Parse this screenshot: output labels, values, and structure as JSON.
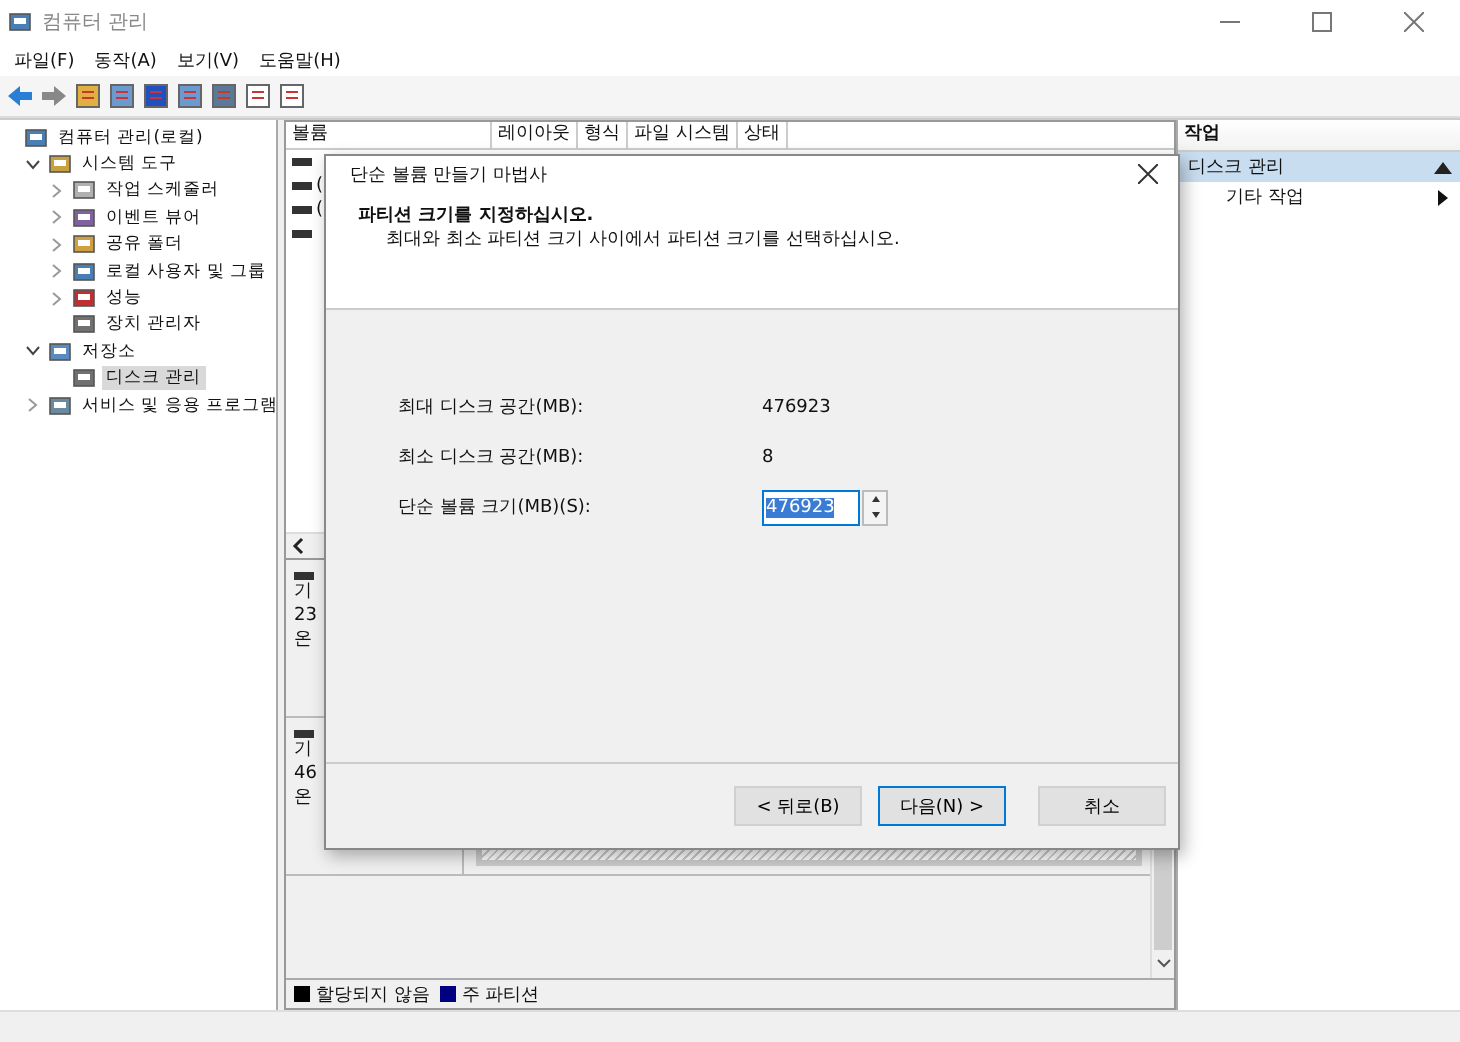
{
  "window": {
    "title": "컴퓨터 관리"
  },
  "menu": [
    "파일(F)",
    "동작(A)",
    "보기(V)",
    "도움말(H)"
  ],
  "tree": [
    {
      "label": "컴퓨터 관리(로컬)",
      "selected": false,
      "children": [
        {
          "label": "시스템 도구",
          "expanded": true,
          "selected": false,
          "children": [
            {
              "label": "작업 스케줄러",
              "expanded": false,
              "selected": false
            },
            {
              "label": "이벤트 뷰어",
              "expanded": false,
              "selected": false
            },
            {
              "label": "공유 폴더",
              "expanded": false,
              "selected": false
            },
            {
              "label": "로컬 사용자 및 그룹",
              "expanded": false,
              "selected": false
            },
            {
              "label": "성능",
              "expanded": false,
              "selected": false
            },
            {
              "label": "장치 관리자",
              "selected": false
            }
          ]
        },
        {
          "label": "저장소",
          "expanded": true,
          "selected": false,
          "children": [
            {
              "label": "디스크 관리",
              "selected": true
            }
          ]
        },
        {
          "label": "서비스 및 응용 프로그램",
          "expanded": false,
          "selected": false
        }
      ]
    }
  ],
  "volume_table": {
    "columns": [
      "볼륨",
      "레이아웃",
      "형식",
      "파일 시스템",
      "상태"
    ],
    "rows": [
      {
        "text": ""
      },
      {
        "text": "("
      },
      {
        "text": "("
      },
      {
        "text": ""
      }
    ]
  },
  "disks": [
    {
      "kind": "covered",
      "lines": [
        "기",
        "23",
        "온"
      ]
    },
    {
      "kind": "unallocated",
      "lines": [
        "기",
        "46",
        "온"
      ]
    }
  ],
  "legend": [
    {
      "label": "할당되지 않음",
      "color": "#000000"
    },
    {
      "label": "주 파티션",
      "color": "#000080"
    }
  ],
  "actions": {
    "title": "작업",
    "section": "디스크 관리",
    "items": [
      "기타 작업"
    ]
  },
  "dialog": {
    "title": "단순 볼륨 만들기 마법사",
    "heading": "파티션 크기를 지정하십시오.",
    "subheading": "최대와 최소 파티션 크기 사이에서 파티션 크기를 선택하십시오.",
    "fields": [
      {
        "kind": "text",
        "label": "최대 디스크 공간(MB):",
        "value": "476923"
      },
      {
        "kind": "text",
        "label": "최소 디스크 공간(MB):",
        "value": "8"
      },
      {
        "kind": "spin",
        "label": "단순 볼륨 크기(MB)(S):",
        "value": "476923"
      }
    ],
    "buttons": [
      {
        "label": "< 뒤로(B)",
        "default": false
      },
      {
        "label": "다음(N) >",
        "default": true
      },
      {
        "label": "취소",
        "default": false
      }
    ]
  }
}
